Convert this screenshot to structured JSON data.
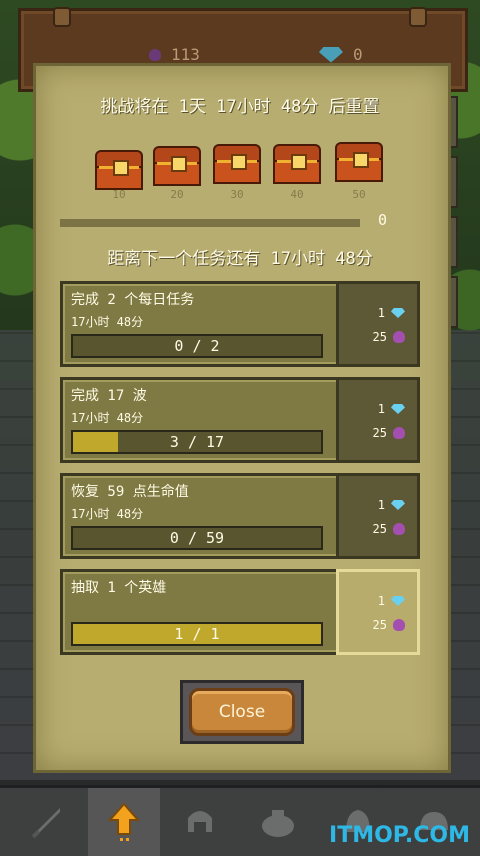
{
  "header": {
    "gems_count": "113",
    "diamonds_count": "0"
  },
  "challenge": {
    "reset_text": "挑战将在 1天 17小时 48分 后重置",
    "chest_milestones": [
      "10",
      "20",
      "30",
      "40",
      "50"
    ],
    "progress_value": "0",
    "next_task_text": "距离下一个任务还有 17小时 48分"
  },
  "tasks": [
    {
      "title": "完成 2 个每日任务",
      "time": "17小时 48分",
      "progress_text": "0 / 2",
      "progress_fraction": 0,
      "reward_diamonds": "1",
      "reward_gems": "25"
    },
    {
      "title": "完成 17 波",
      "time": "17小时 48分",
      "progress_text": "3 / 17",
      "progress_fraction": 0.18,
      "reward_diamonds": "1",
      "reward_gems": "25"
    },
    {
      "title": "恢复 59 点生命值",
      "time": "17小时 48分",
      "progress_text": "0 / 59",
      "progress_fraction": 0,
      "reward_diamonds": "1",
      "reward_gems": "25"
    },
    {
      "title": "抽取 1 个英雄",
      "time": "",
      "progress_text": "1 / 1",
      "progress_fraction": 1,
      "reward_diamonds": "1",
      "reward_gems": "25"
    }
  ],
  "close_label": "Close",
  "nav": [
    "sword-icon",
    "arrow-up-icon",
    "helmet-icon",
    "pot-icon",
    "bell-icon",
    "dome-icon"
  ],
  "watermark": "ITMOP.COM",
  "colors": {
    "bar_fill": "#c0a82c",
    "parchment": "#b8ad70",
    "gem": "#6ad0f0",
    "potion": "#a44fb0"
  }
}
